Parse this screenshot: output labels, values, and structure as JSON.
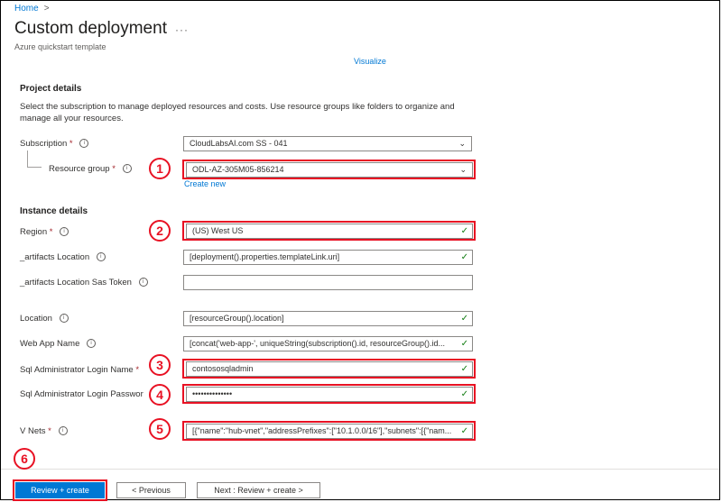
{
  "breadcrumb": {
    "home": "Home",
    "separator": ">"
  },
  "header": {
    "title": "Custom deployment",
    "more": "···",
    "subtitle": "Azure quickstart template"
  },
  "visualize_link": "Visualize",
  "project_details": {
    "heading": "Project details",
    "description": "Select the subscription to manage deployed resources and costs. Use resource groups like folders to organize and manage all your resources.",
    "subscription": {
      "label": "Subscription",
      "required": "*",
      "value": "CloudLabsAI.com SS - 041"
    },
    "resource_group": {
      "label": "Resource group",
      "required": "*",
      "value": "ODL-AZ-305M05-856214",
      "create_new": "Create new"
    }
  },
  "instance_details": {
    "heading": "Instance details",
    "region": {
      "label": "Region",
      "required": "*",
      "value": "(US) West US"
    },
    "artifacts_location": {
      "label": "_artifacts Location",
      "value": "[deployment().properties.templateLink.uri]"
    },
    "artifacts_sas": {
      "label": "_artifacts Location Sas Token",
      "value": ""
    },
    "location": {
      "label": "Location",
      "value": "[resourceGroup().location]"
    },
    "web_app_name": {
      "label": "Web App Name",
      "value": "[concat('web-app-', uniqueString(subscription().id, resourceGroup().id..."
    },
    "sql_login_name": {
      "label": "Sql Administrator Login Name",
      "required": "*",
      "value": "contososqladmin"
    },
    "sql_login_password": {
      "label": "Sql Administrator Login Passwor",
      "required": "*",
      "value": "••••••••••••••"
    },
    "vnets": {
      "label": "V Nets",
      "required": "*",
      "value": "[{\"name\":\"hub-vnet\",\"addressPrefixes\":[\"10.1.0.0/16\"],\"subnets\":[{\"nam..."
    }
  },
  "footer": {
    "review_create": "Review + create",
    "previous": "< Previous",
    "next": "Next : Review + create >"
  },
  "step_badges": [
    "1",
    "2",
    "3",
    "4",
    "5",
    "6"
  ],
  "icons": {
    "info": "i",
    "check": "✓",
    "chevron": "chevron-down-icon"
  },
  "colors": {
    "accent": "#0078d4",
    "highlight": "#e81123",
    "valid": "#107c10"
  }
}
